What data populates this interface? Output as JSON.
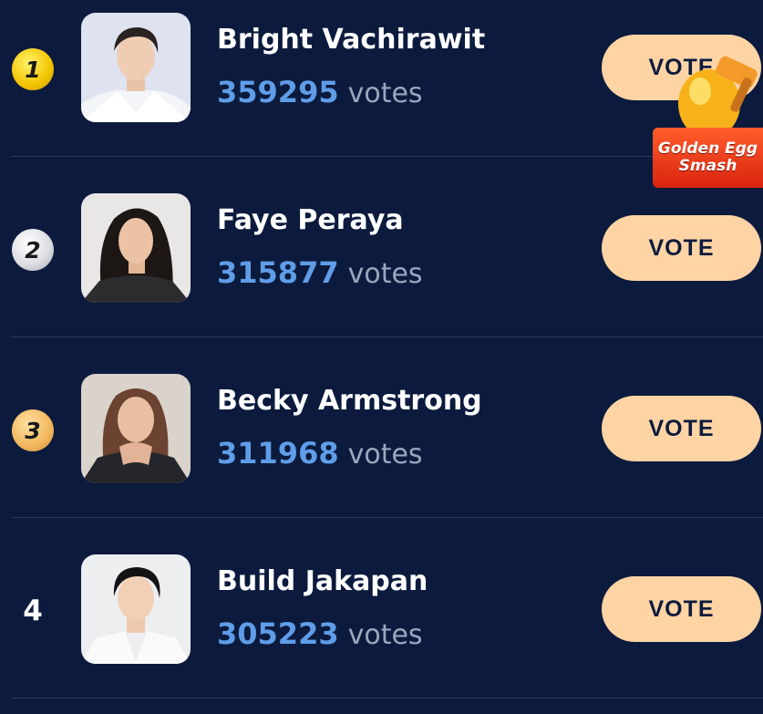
{
  "rows": [
    {
      "rank": "1",
      "name": "Bright Vachirawit",
      "count": "359295",
      "unit": "votes",
      "button": "VOTE"
    },
    {
      "rank": "2",
      "name": "Faye Peraya",
      "count": "315877",
      "unit": "votes",
      "button": "VOTE"
    },
    {
      "rank": "3",
      "name": "Becky Armstrong",
      "count": "311968",
      "unit": "votes",
      "button": "VOTE"
    },
    {
      "rank": "4",
      "name": "Build Jakapan",
      "count": "305223",
      "unit": "votes",
      "button": "VOTE"
    }
  ],
  "promo": {
    "line1": "Golden Egg",
    "line2": "Smash",
    "icon": "golden-egg-hammer-icon"
  },
  "colors": {
    "background": "#0c1b3d",
    "vote_count": "#5f9de8",
    "vote_button": "#ffd4a5",
    "divider": "#2b3a5c"
  }
}
